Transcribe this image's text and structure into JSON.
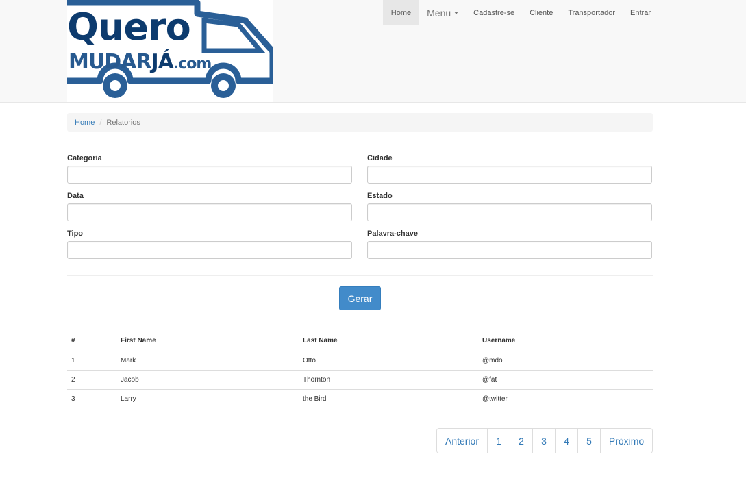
{
  "brand": {
    "logo_line1": "Quero",
    "logo_line2_mudar": "MUDAR",
    "logo_line2_ja": "JÁ",
    "logo_line2_com": ".com",
    "colors": {
      "dark_blue": "#0d3b6e",
      "light_blue": "#27598f"
    }
  },
  "nav": {
    "home": "Home",
    "menu": "Menu",
    "cadastre": "Cadastre-se",
    "cliente": "Cliente",
    "transportador": "Transportador",
    "entrar": "Entrar"
  },
  "breadcrumb": {
    "home": "Home",
    "separator": "/",
    "current": "Relatorios"
  },
  "form": {
    "categoria_label": "Categoria",
    "cidade_label": "Cidade",
    "data_label": "Data",
    "estado_label": "Estado",
    "tipo_label": "Tipo",
    "palavra_label": "Palavra-chave",
    "categoria_value": "",
    "cidade_value": "",
    "data_value": "",
    "estado_value": "",
    "tipo_value": "",
    "palavra_value": ""
  },
  "actions": {
    "gerar": "Gerar",
    "accent": "#428bca"
  },
  "table": {
    "headers": [
      "#",
      "First Name",
      "Last Name",
      "Username"
    ],
    "rows": [
      [
        "1",
        "Mark",
        "Otto",
        "@mdo"
      ],
      [
        "2",
        "Jacob",
        "Thornton",
        "@fat"
      ],
      [
        "3",
        "Larry",
        "the Bird",
        "@twitter"
      ]
    ]
  },
  "pagination": {
    "prev": "Anterior",
    "pages": [
      "1",
      "2",
      "3",
      "4",
      "5"
    ],
    "next": "Próximo"
  }
}
